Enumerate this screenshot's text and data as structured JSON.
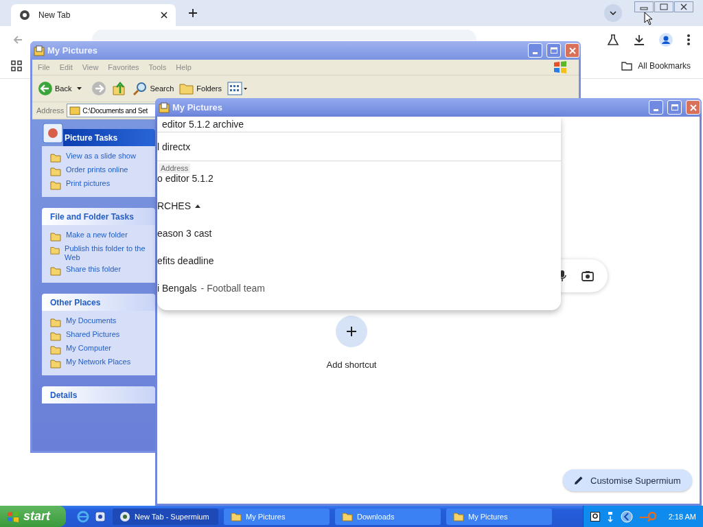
{
  "browser": {
    "tabs": [
      {
        "label": "New Tab",
        "selected": true
      }
    ],
    "bookmarks": [
      {
        "label": "All Bookmarks"
      }
    ],
    "new_tab_page": {
      "shortcut_label": "Add shortcut",
      "customise_button": "Customise Supermium"
    }
  },
  "explorer": {
    "title": "My Pictures",
    "menu": [
      "File",
      "Edit",
      "View",
      "Favorites",
      "Tools",
      "Help"
    ],
    "toolbar": [
      {
        "label": "Back",
        "kind": "back"
      },
      {
        "label": "Search",
        "kind": "search"
      },
      {
        "label": "Folders",
        "kind": "folders"
      }
    ],
    "address_label": "Address",
    "address_value": "C:\\Documents and Set",
    "panels": [
      {
        "title": "Picture Tasks",
        "kind": "special",
        "items": [
          "View as a slide show",
          "Order prints online",
          "Print pictures"
        ]
      },
      {
        "title": "File and Folder Tasks",
        "kind": "plain",
        "items": [
          "Make a new folder",
          "Publish this folder to the Web",
          "Share this folder"
        ]
      },
      {
        "title": "Other Places",
        "kind": "plain",
        "items": [
          "My Documents",
          "Shared Pictures",
          "My Computer",
          "My Network Places"
        ]
      },
      {
        "title": "Details",
        "kind": "plain"
      }
    ]
  },
  "front_window": {
    "title": "My Pictures",
    "tooltip": "Address",
    "suggestions": [
      {
        "kind": "item",
        "text": "editor 5.1.2 archive",
        "divider": true
      },
      {
        "kind": "item",
        "text": "l directx",
        "divider": true
      },
      {
        "kind": "item",
        "text": "o editor 5.1.2",
        "divider": false
      },
      {
        "kind": "section",
        "text": "RCHES",
        "divider": false
      },
      {
        "kind": "item",
        "text": "eason 3 cast",
        "divider": false
      },
      {
        "kind": "item",
        "text": "efits deadline",
        "divider": false
      },
      {
        "kind": "item",
        "text": "i Bengals",
        "detail": "- Football team",
        "divider": false
      }
    ]
  },
  "taskbar": {
    "start": "start",
    "tasks": [
      {
        "label": "New Tab - Supermium",
        "kind": "browser",
        "selected": true
      },
      {
        "label": "My Pictures",
        "kind": "folder",
        "selected": false
      },
      {
        "label": "Downloads",
        "kind": "folder",
        "selected": false
      },
      {
        "label": "My Pictures",
        "kind": "folder",
        "selected": false
      }
    ],
    "clock": "2:18 AM"
  }
}
